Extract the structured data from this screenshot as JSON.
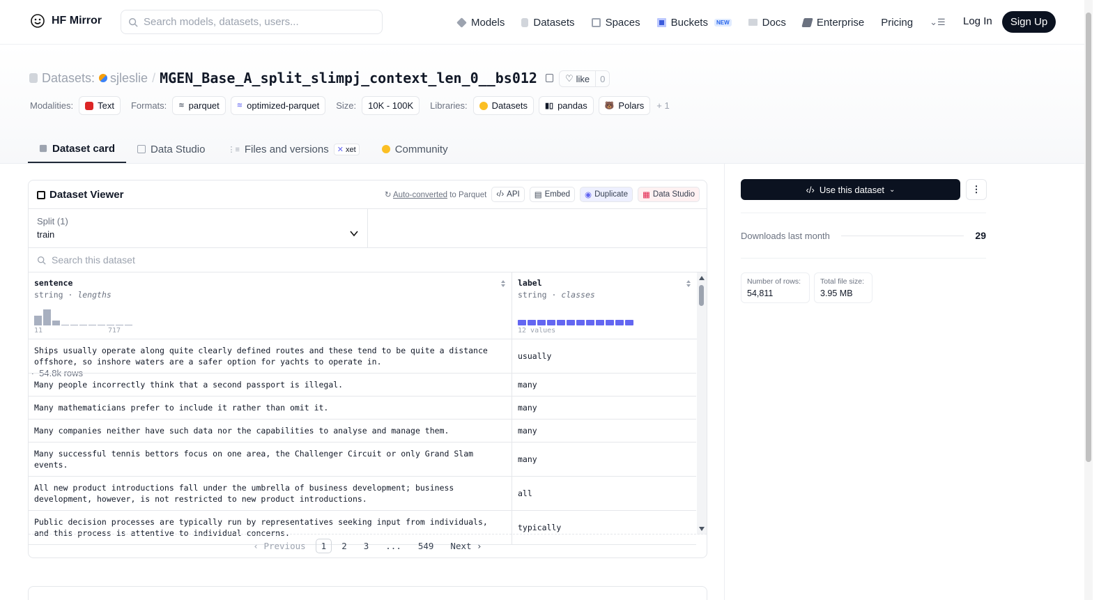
{
  "nav": {
    "brand": "HF Mirror",
    "search_placeholder": "Search models, datasets, users...",
    "links": [
      {
        "label": "Models",
        "icon": "cube-icon"
      },
      {
        "label": "Datasets",
        "icon": "database-icon"
      },
      {
        "label": "Spaces",
        "icon": "grid-icon"
      },
      {
        "label": "Buckets",
        "icon": "bucket-icon",
        "badge": "NEW"
      },
      {
        "label": "Docs",
        "icon": "book-icon"
      },
      {
        "label": "Enterprise",
        "icon": "building-icon"
      },
      {
        "label": "Pricing"
      }
    ],
    "login": "Log In",
    "signup": "Sign Up"
  },
  "header": {
    "section_label": "Datasets:",
    "owner": "sjleslie",
    "separator": "/",
    "dataset_name": "MGEN_Base_A_split_slimpj_context_len_0__bs012",
    "like_label": "like",
    "like_count": "0",
    "modalities_label": "Modalities:",
    "modality": "Text",
    "formats_label": "Formats:",
    "formats": [
      "parquet",
      "optimized-parquet"
    ],
    "size_label": "Size:",
    "size": "10K - 100K",
    "libraries_label": "Libraries:",
    "libraries": [
      "Datasets",
      "pandas",
      "Polars"
    ],
    "more_libraries": "+ 1"
  },
  "tabs": [
    {
      "label": "Dataset card",
      "active": true
    },
    {
      "label": "Data Studio"
    },
    {
      "label": "Files and versions",
      "badge": "xet"
    },
    {
      "label": "Community"
    }
  ],
  "viewer": {
    "title": "Dataset Viewer",
    "auto_converted_link": "Auto-converted",
    "auto_converted_suffix": "to Parquet",
    "tools": [
      "API",
      "Embed",
      "Duplicate",
      "Data Studio"
    ],
    "split_label": "Split (1)",
    "split_name": "train",
    "split_rows": "54.8k rows",
    "search_placeholder": "Search this dataset",
    "columns": [
      {
        "name": "sentence",
        "type": "string",
        "stat": "lengths",
        "min": "11",
        "max": "717"
      },
      {
        "name": "label",
        "type": "string",
        "stat": "classes",
        "summary": "12 values"
      }
    ],
    "histogram": [
      0.55,
      0.9,
      0.28,
      0.04,
      0.02,
      0.02,
      0.02,
      0.02,
      0.02,
      0.02,
      0.02
    ],
    "class_bars": 12,
    "rows": [
      {
        "sentence": "Ships usually operate along quite clearly defined routes and these tend to be quite a distance offshore, so inshore waters are a safer option for yachts to operate in.",
        "label": "usually"
      },
      {
        "sentence": "Many people incorrectly think that a second passport is illegal.",
        "label": "many"
      },
      {
        "sentence": "Many mathematicians prefer to include it rather than omit it.",
        "label": "many"
      },
      {
        "sentence": "Many companies neither have such data nor the capabilities to analyse and manage them.",
        "label": "many"
      },
      {
        "sentence": "Many successful tennis bettors focus on one area, the Challenger Circuit or only Grand Slam events.",
        "label": "many"
      },
      {
        "sentence": "All new product introductions fall under the umbrella of business development; business development, however, is not restricted to new product introductions.",
        "label": "all"
      },
      {
        "sentence": "Public decision processes are typically run by representatives seeking input from individuals, and this process is attentive to individual concerns.",
        "label": "typically"
      }
    ],
    "pager": {
      "prev": "Previous",
      "pages": [
        "1",
        "2",
        "3",
        "...",
        "549"
      ],
      "next": "Next",
      "current": "1"
    }
  },
  "sidebar": {
    "use_button": "Use this dataset",
    "downloads_label": "Downloads last month",
    "downloads_value": "29",
    "rows_label": "Number of rows:",
    "rows_value": "54,811",
    "size_label": "Total file size:",
    "size_value": "3.95 MB"
  }
}
